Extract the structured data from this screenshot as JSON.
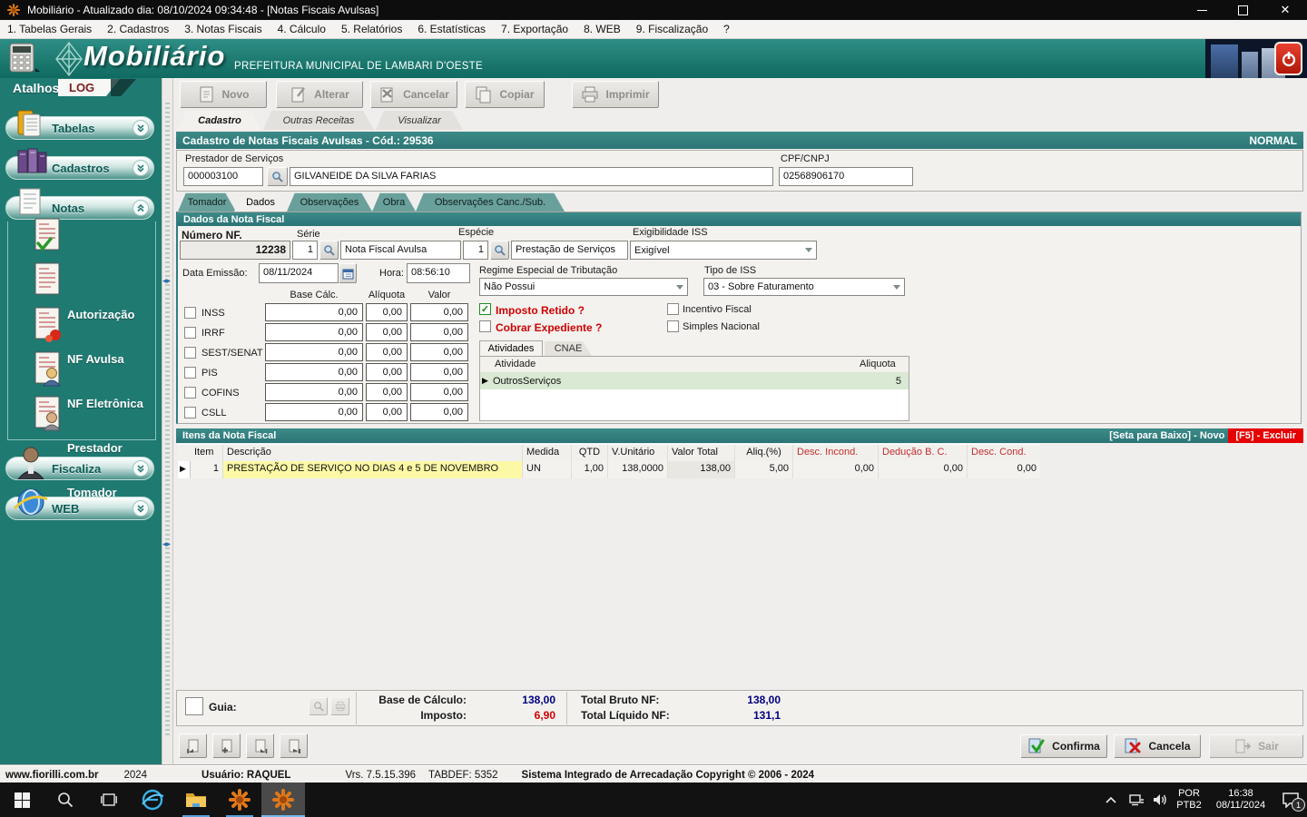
{
  "colors": {
    "teal_header": "#1f7a72",
    "teal_bar": "#2f7d7e",
    "navy_value": "#00007f",
    "red_text": "#cf0000",
    "row_yellow": "#fcf9a6",
    "row_green": "#d9e9d3",
    "excluir_red": "#e60000"
  },
  "window": {
    "title": "Mobiliário - Atualizado dia: 08/10/2024 09:34:48 - [Notas Fiscais Avulsas]"
  },
  "menu": {
    "items": [
      "1. Tabelas Gerais",
      "2. Cadastros",
      "3. Notas Fiscais",
      "4. Cálculo",
      "5. Relatórios",
      "6. Estatísticas",
      "7. Exportação",
      "8. WEB",
      "9. Fiscalização",
      "?"
    ]
  },
  "header": {
    "logo": "Mobiliário",
    "org": "PREFEITURA MUNICIPAL DE LAMBARI D'OESTE"
  },
  "sidebar": {
    "tab": "Atalhos",
    "log": "LOG",
    "groups": {
      "tabelas": "Tabelas",
      "cadastros": "Cadastros",
      "notas": "Notas",
      "fiscaliza": "Fiscaliza",
      "web": "WEB"
    },
    "notas_items": [
      "Autorização",
      "NF Avulsa",
      "NF Eletrônica",
      "Prestador",
      "Tomador"
    ]
  },
  "toolbar": {
    "novo": "Novo",
    "alterar": "Alterar",
    "cancelar": "Cancelar",
    "copiar": "Copiar",
    "imprimir": "Imprimir"
  },
  "outer_tabs": {
    "cadastro": "Cadastro",
    "outras": "Outras Receitas",
    "visualizar": "Visualizar"
  },
  "form": {
    "title": "Cadastro de Notas Fiscais Avulsas - Cód.: 29536",
    "status": "NORMAL",
    "prestador_label": "Prestador de Serviços",
    "prestador_code": "000003100",
    "prestador_name": "GILVANEIDE DA SILVA FARIAS",
    "cpf_label": "CPF/CNPJ",
    "cpf": "02568906170",
    "tabs": [
      "Tomador",
      "Dados",
      "Observações",
      "Obra",
      "Observações Canc./Sub."
    ]
  },
  "dados": {
    "title": "Dados da Nota Fiscal",
    "numero_label": "Número NF.",
    "numero": "12238",
    "serie_label": "Série",
    "serie": "1",
    "serie_desc": "Nota Fiscal Avulsa",
    "especie_label": "Espécie",
    "especie_num": "1",
    "especie_desc": "Prestação de Serviços",
    "exig_label": "Exigibilidade ISS",
    "exig": "Exigível",
    "data_label": "Data Emissão:",
    "data": "08/11/2024",
    "hora_label": "Hora:",
    "hora": "08:56:10",
    "regime_label": "Regime Especial de Tributação",
    "regime": "Não Possui",
    "tipo_label": "Tipo de ISS",
    "tipo": "03 - Sobre Faturamento",
    "col_base": "Base Cálc.",
    "col_aliq": "Alíquota",
    "col_valor": "Valor",
    "taxes": [
      {
        "name": "INSS",
        "base": "0,00",
        "aliq": "0,00",
        "valor": "0,00"
      },
      {
        "name": "IRRF",
        "base": "0,00",
        "aliq": "0,00",
        "valor": "0,00"
      },
      {
        "name": "SEST/SENAT",
        "base": "0,00",
        "aliq": "0,00",
        "valor": "0,00"
      },
      {
        "name": "PIS",
        "base": "0,00",
        "aliq": "0,00",
        "valor": "0,00"
      },
      {
        "name": "COFINS",
        "base": "0,00",
        "aliq": "0,00",
        "valor": "0,00"
      },
      {
        "name": "CSLL",
        "base": "0,00",
        "aliq": "0,00",
        "valor": "0,00"
      }
    ],
    "imposto_retido": "Imposto Retido ?",
    "cobrar_expediente": "Cobrar Expediente ?",
    "incentivo": "Incentivo Fiscal",
    "simples": "Simples Nacional",
    "atividades_tab": "Atividades",
    "cnae_tab": "CNAE",
    "atividade_col": "Atividade",
    "aliquota_col": "Aliquota",
    "atividade": "OutrosServiços",
    "atividade_aliq": "5"
  },
  "itens": {
    "title": "Itens da Nota Fiscal",
    "hint_novo": "[Seta para Baixo] - Novo",
    "hint_excluir": "[F5] - Excluir",
    "headers": [
      "Item",
      "Descrição",
      "Medida",
      "QTD",
      "V.Unitário",
      "Valor Total",
      "Aliq.(%)",
      "Desc. Incond.",
      "Dedução B. C.",
      "Desc. Cond."
    ],
    "row": {
      "item": "1",
      "descricao": "PRESTAÇÃO DE SERVIÇO NO DIAS 4 e 5 DE NOVEMBRO",
      "medida": "UN",
      "qtd": "1,00",
      "v_unitario": "138,0000",
      "valor_total": "138,00",
      "aliq": "5,00",
      "desc_incond": "0,00",
      "deducao": "0,00",
      "desc_cond": "0,00"
    }
  },
  "totals": {
    "guia": "Guia:",
    "base_label": "Base de Cálculo:",
    "base": "138,00",
    "imposto_label": "Imposto:",
    "imposto": "6,90",
    "bruto_label": "Total Bruto NF:",
    "bruto": "138,00",
    "liquido_label": "Total Líquido NF:",
    "liquido": "131,1"
  },
  "actions": {
    "confirma": "Confirma",
    "cancela": "Cancela",
    "sair": "Sair"
  },
  "statusbar": {
    "site": "www.fiorilli.com.br",
    "year": "2024",
    "user": "Usuário: RAQUEL",
    "version": "Vrs. 7.5.15.396",
    "tabdef": "TABDEF: 5352",
    "copyright": "Sistema Integrado de Arrecadação Copyright © 2006 - 2024"
  },
  "taskbar": {
    "lang_top": "POR",
    "lang_bottom": "PTB2",
    "time": "16:38",
    "date": "08/11/2024",
    "badge": "1"
  }
}
